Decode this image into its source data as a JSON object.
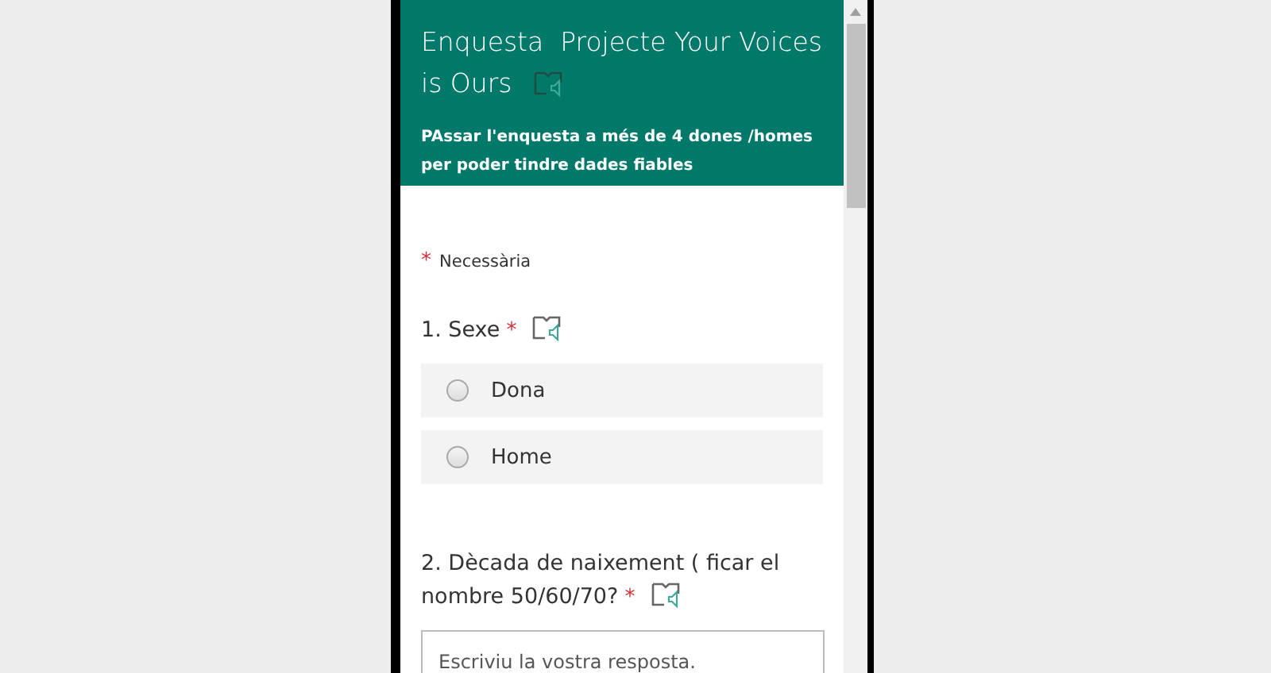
{
  "header": {
    "title": "Enquesta  Projecte Your Voices is Ours",
    "subtitle": "PAssar l'enquesta a més de 4 dones /homes per poder tindre dades fiables"
  },
  "required_note": {
    "mark": "*",
    "label": "Necessària"
  },
  "questions": [
    {
      "kind": "choice",
      "number": "1.",
      "text": "Sexe",
      "required": true,
      "options": [
        {
          "label": "Dona",
          "selected": false
        },
        {
          "label": "Home",
          "selected": false
        }
      ]
    },
    {
      "kind": "text",
      "number": "2.",
      "text": "Dècada de naixement ( ficar el nombre 50/60/70?",
      "required": true,
      "placeholder": "Escriviu la vostra resposta."
    }
  ]
}
